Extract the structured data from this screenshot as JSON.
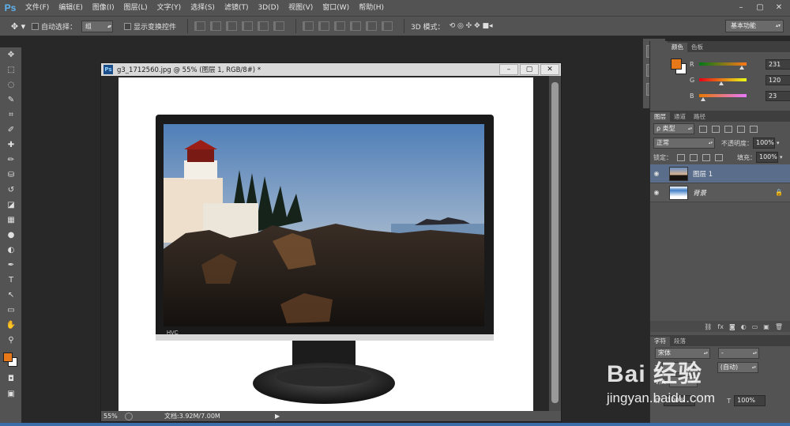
{
  "app": {
    "logo": "Ps"
  },
  "menu": [
    "文件(F)",
    "编辑(E)",
    "图像(I)",
    "图层(L)",
    "文字(Y)",
    "选择(S)",
    "滤镜(T)",
    "3D(D)",
    "视图(V)",
    "窗口(W)",
    "帮助(H)"
  ],
  "window_controls": [
    "–",
    "▢",
    "✕"
  ],
  "options": {
    "tool_icon": "move-tool-icon",
    "auto_select_label": "自动选择：",
    "auto_select_value": "组",
    "show_transform_label": "显示变换控件",
    "mode_3d_label": "3D 模式：",
    "workspace": "基本功能"
  },
  "toolbox": {
    "tools": [
      "move-tool-icon",
      "marquee-tool-icon",
      "lasso-tool-icon",
      "quick-select-tool-icon",
      "crop-tool-icon",
      "eyedropper-tool-icon",
      "healing-brush-tool-icon",
      "brush-tool-icon",
      "clone-stamp-tool-icon",
      "history-brush-tool-icon",
      "eraser-tool-icon",
      "gradient-tool-icon",
      "blur-tool-icon",
      "dodge-tool-icon",
      "pen-tool-icon",
      "type-tool-icon",
      "path-select-tool-icon",
      "rectangle-tool-icon",
      "hand-tool-icon",
      "zoom-tool-icon"
    ],
    "glyphs": [
      "✥",
      "⬚",
      "◌",
      "✎",
      "⌗",
      "✐",
      "✚",
      "✏",
      "⛁",
      "↺",
      "◪",
      "▦",
      "●",
      "◐",
      "✒",
      "T",
      "↖",
      "▭",
      "✋",
      "⚲"
    ],
    "fg_color": "#e7781a",
    "bg_color": "#ffffff"
  },
  "document": {
    "title": "g3_1712560.jpg @ 55% (图层 1, RGB/8#) *",
    "zoom": "55%",
    "doc_info": "文档:3.92M/7.00M",
    "buttons": [
      "–",
      "▢",
      "✕"
    ],
    "monitor_brand": "HVC"
  },
  "color_panel": {
    "tabs": [
      "颜色",
      "色板"
    ],
    "channels": [
      {
        "label": "R",
        "value": "231",
        "level": 0.906
      },
      {
        "label": "G",
        "value": "120",
        "level": 0.471
      },
      {
        "label": "B",
        "value": "23",
        "level": 0.09
      }
    ],
    "fg": "#e7781a",
    "bg": "#ffffff"
  },
  "layers_panel": {
    "tabs": [
      "图层",
      "通道",
      "路径"
    ],
    "filter_label": "ρ 类型",
    "blend_mode": "正常",
    "opacity_label": "不透明度：",
    "opacity_value": "100%",
    "lock_label": "锁定：",
    "fill_label": "填充：",
    "fill_value": "100%",
    "layers": [
      {
        "name": "图层 1",
        "selected": true,
        "locked": false
      },
      {
        "name": "背景",
        "selected": false,
        "locked": true
      }
    ],
    "footer_icons": [
      "link-icon",
      "fx-icon",
      "mask-icon",
      "adjustment-icon",
      "folder-icon",
      "new-layer-icon",
      "trash-icon"
    ],
    "footer_glyphs": [
      "⛓",
      "fx",
      "◙",
      "◐",
      "▭",
      "▣",
      "🗑"
    ]
  },
  "char_panel": {
    "tabs": [
      "字符",
      "段落"
    ],
    "font_value": "宋体",
    "style_value": "-",
    "size_value": "(自动)",
    "scale_v": "100%",
    "scale_h": "100%"
  },
  "watermark": {
    "brand": "Bai 经验",
    "url": "jingyan.baidu.com"
  }
}
